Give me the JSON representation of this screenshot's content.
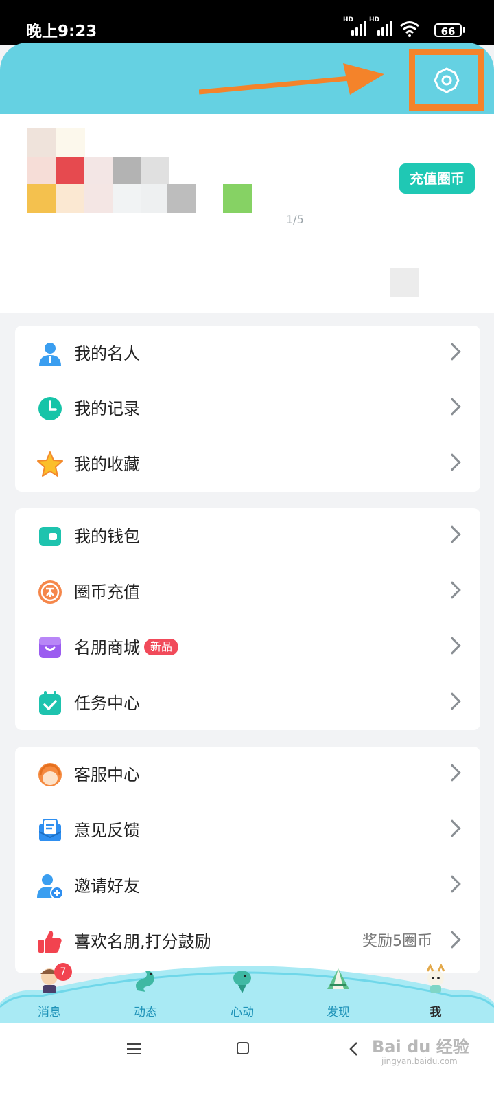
{
  "status_bar": {
    "time": "晚上9:23",
    "signal1_label": "HD",
    "signal2_label": "HD",
    "battery": "66"
  },
  "header": {
    "settings_icon": "gear-icon",
    "highlight_color": "#f4832a",
    "bar_color": "#65d1e2"
  },
  "profile": {
    "recharge_label": "充值圈币",
    "page_indicator": "1/5"
  },
  "menu_groups": [
    {
      "items": [
        {
          "label": "我的名人",
          "icon": "person-icon"
        },
        {
          "label": "我的记录",
          "icon": "clock-icon"
        },
        {
          "label": "我的收藏",
          "icon": "star-icon"
        }
      ]
    },
    {
      "items": [
        {
          "label": "我的钱包",
          "icon": "wallet-icon"
        },
        {
          "label": "圈币充值",
          "icon": "coin-icon"
        },
        {
          "label": "名朋商城",
          "icon": "shop-icon",
          "badge": "新品"
        },
        {
          "label": "任务中心",
          "icon": "calendar-check-icon"
        }
      ]
    },
    {
      "items": [
        {
          "label": "客服中心",
          "icon": "support-icon"
        },
        {
          "label": "意见反馈",
          "icon": "feedback-icon"
        },
        {
          "label": "邀请好友",
          "icon": "invite-user-icon"
        },
        {
          "label": "喜欢名朋,打分鼓励",
          "icon": "thumbs-up-icon",
          "extra": "奖励5圈币"
        }
      ]
    }
  ],
  "tabs": [
    {
      "label": "消息",
      "badge": "7"
    },
    {
      "label": "动态"
    },
    {
      "label": "心动"
    },
    {
      "label": "发现"
    },
    {
      "label": "我",
      "active": true
    }
  ],
  "watermark": {
    "brand": "Bai du 经验",
    "url": "jingyan.baidu.com"
  }
}
